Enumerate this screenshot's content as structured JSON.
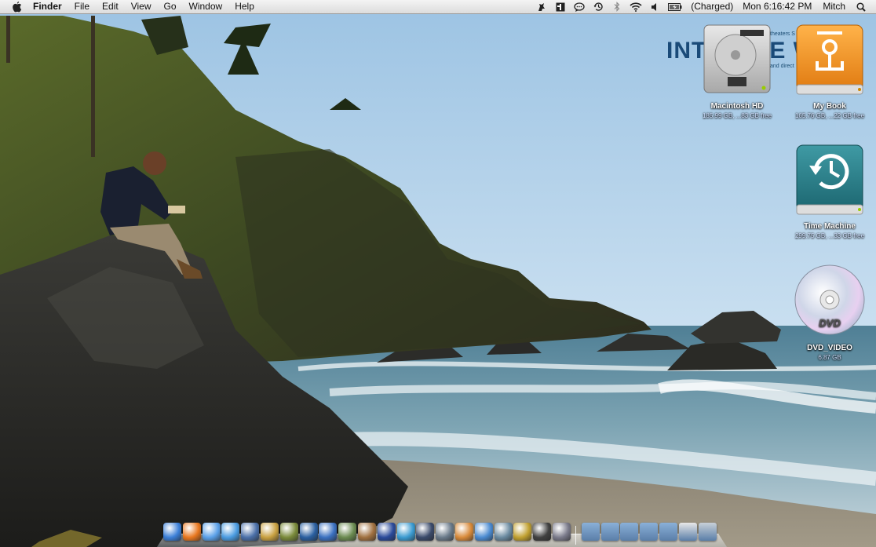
{
  "menubar": {
    "app_name": "Finder",
    "menus": [
      "File",
      "Edit",
      "View",
      "Go",
      "Window",
      "Help"
    ],
    "battery_status": "(Charged)",
    "clock": "Mon 6:16:42 PM",
    "user": "Mitch",
    "status_icons": [
      "growl-icon",
      "input-menu-icon",
      "ichat-icon",
      "time-machine-icon",
      "bluetooth-icon",
      "wifi-icon",
      "volume-icon",
      "battery-icon"
    ]
  },
  "billboard": {
    "line1": "theaters S",
    "big": "INT",
    "big_right": "E W",
    "line2": "and direct"
  },
  "desktop_icons": [
    {
      "name": "Macintosh HD",
      "info": "185.99 GB, ...83 GB free"
    },
    {
      "name": "My Book",
      "info": "165.76 GB, ...22 GB free"
    },
    {
      "name": "Time Machine",
      "info": "299.75 GB, ...33 GB free"
    },
    {
      "name": "DVD_VIDEO",
      "info": "6.87 GB"
    }
  ],
  "dock": {
    "apps": [
      {
        "icon": "finder-icon",
        "color": "#3b7fd8"
      },
      {
        "icon": "firefox-icon",
        "color": "#e8771f"
      },
      {
        "icon": "itunes-icon",
        "color": "#5aa0e8"
      },
      {
        "icon": "ichat-icon",
        "color": "#4a9be0"
      },
      {
        "icon": "preview-icon",
        "color": "#4a6fa8"
      },
      {
        "icon": "photoshop-icon",
        "color": "#c8a040"
      },
      {
        "icon": "textwrangler-icon",
        "color": "#7a8a3a"
      },
      {
        "icon": "imovie-icon",
        "color": "#2a5fa0"
      },
      {
        "icon": "safari-icon",
        "color": "#3a70c0"
      },
      {
        "icon": "camino-icon",
        "color": "#6a8a50"
      },
      {
        "icon": "iphoto-icon",
        "color": "#a07040"
      },
      {
        "icon": "cyberduck-icon",
        "color": "#2a4a9a"
      },
      {
        "icon": "network-icon",
        "color": "#3a9ad0"
      },
      {
        "icon": "dashboard-icon",
        "color": "#3a4a6a"
      },
      {
        "icon": "guitar-icon",
        "color": "#6a7a8a"
      },
      {
        "icon": "keynote-icon",
        "color": "#d88a3a"
      },
      {
        "icon": "pages-icon",
        "color": "#4a8ad0"
      },
      {
        "icon": "backup-icon",
        "color": "#6a8aa0"
      },
      {
        "icon": "mplayer-icon",
        "color": "#c0a030"
      },
      {
        "icon": "chess-icon",
        "color": "#404040"
      },
      {
        "icon": "system-preferences-icon",
        "color": "#7a7a8a"
      }
    ],
    "folders": [
      {
        "icon": "applications-folder-icon",
        "color": "#8ab0d8"
      },
      {
        "icon": "documents-folder-icon",
        "color": "#8ab0d8"
      },
      {
        "icon": "downloads-folder-icon",
        "color": "#8ab0d8"
      },
      {
        "icon": "pictures-folder-icon",
        "color": "#8ab0d8"
      },
      {
        "icon": "applications-stack-icon",
        "color": "#8ab0d8"
      },
      {
        "icon": "document-icon",
        "color": "#e8e8e8"
      },
      {
        "icon": "trash-icon",
        "color": "#c8d0d8"
      }
    ]
  }
}
